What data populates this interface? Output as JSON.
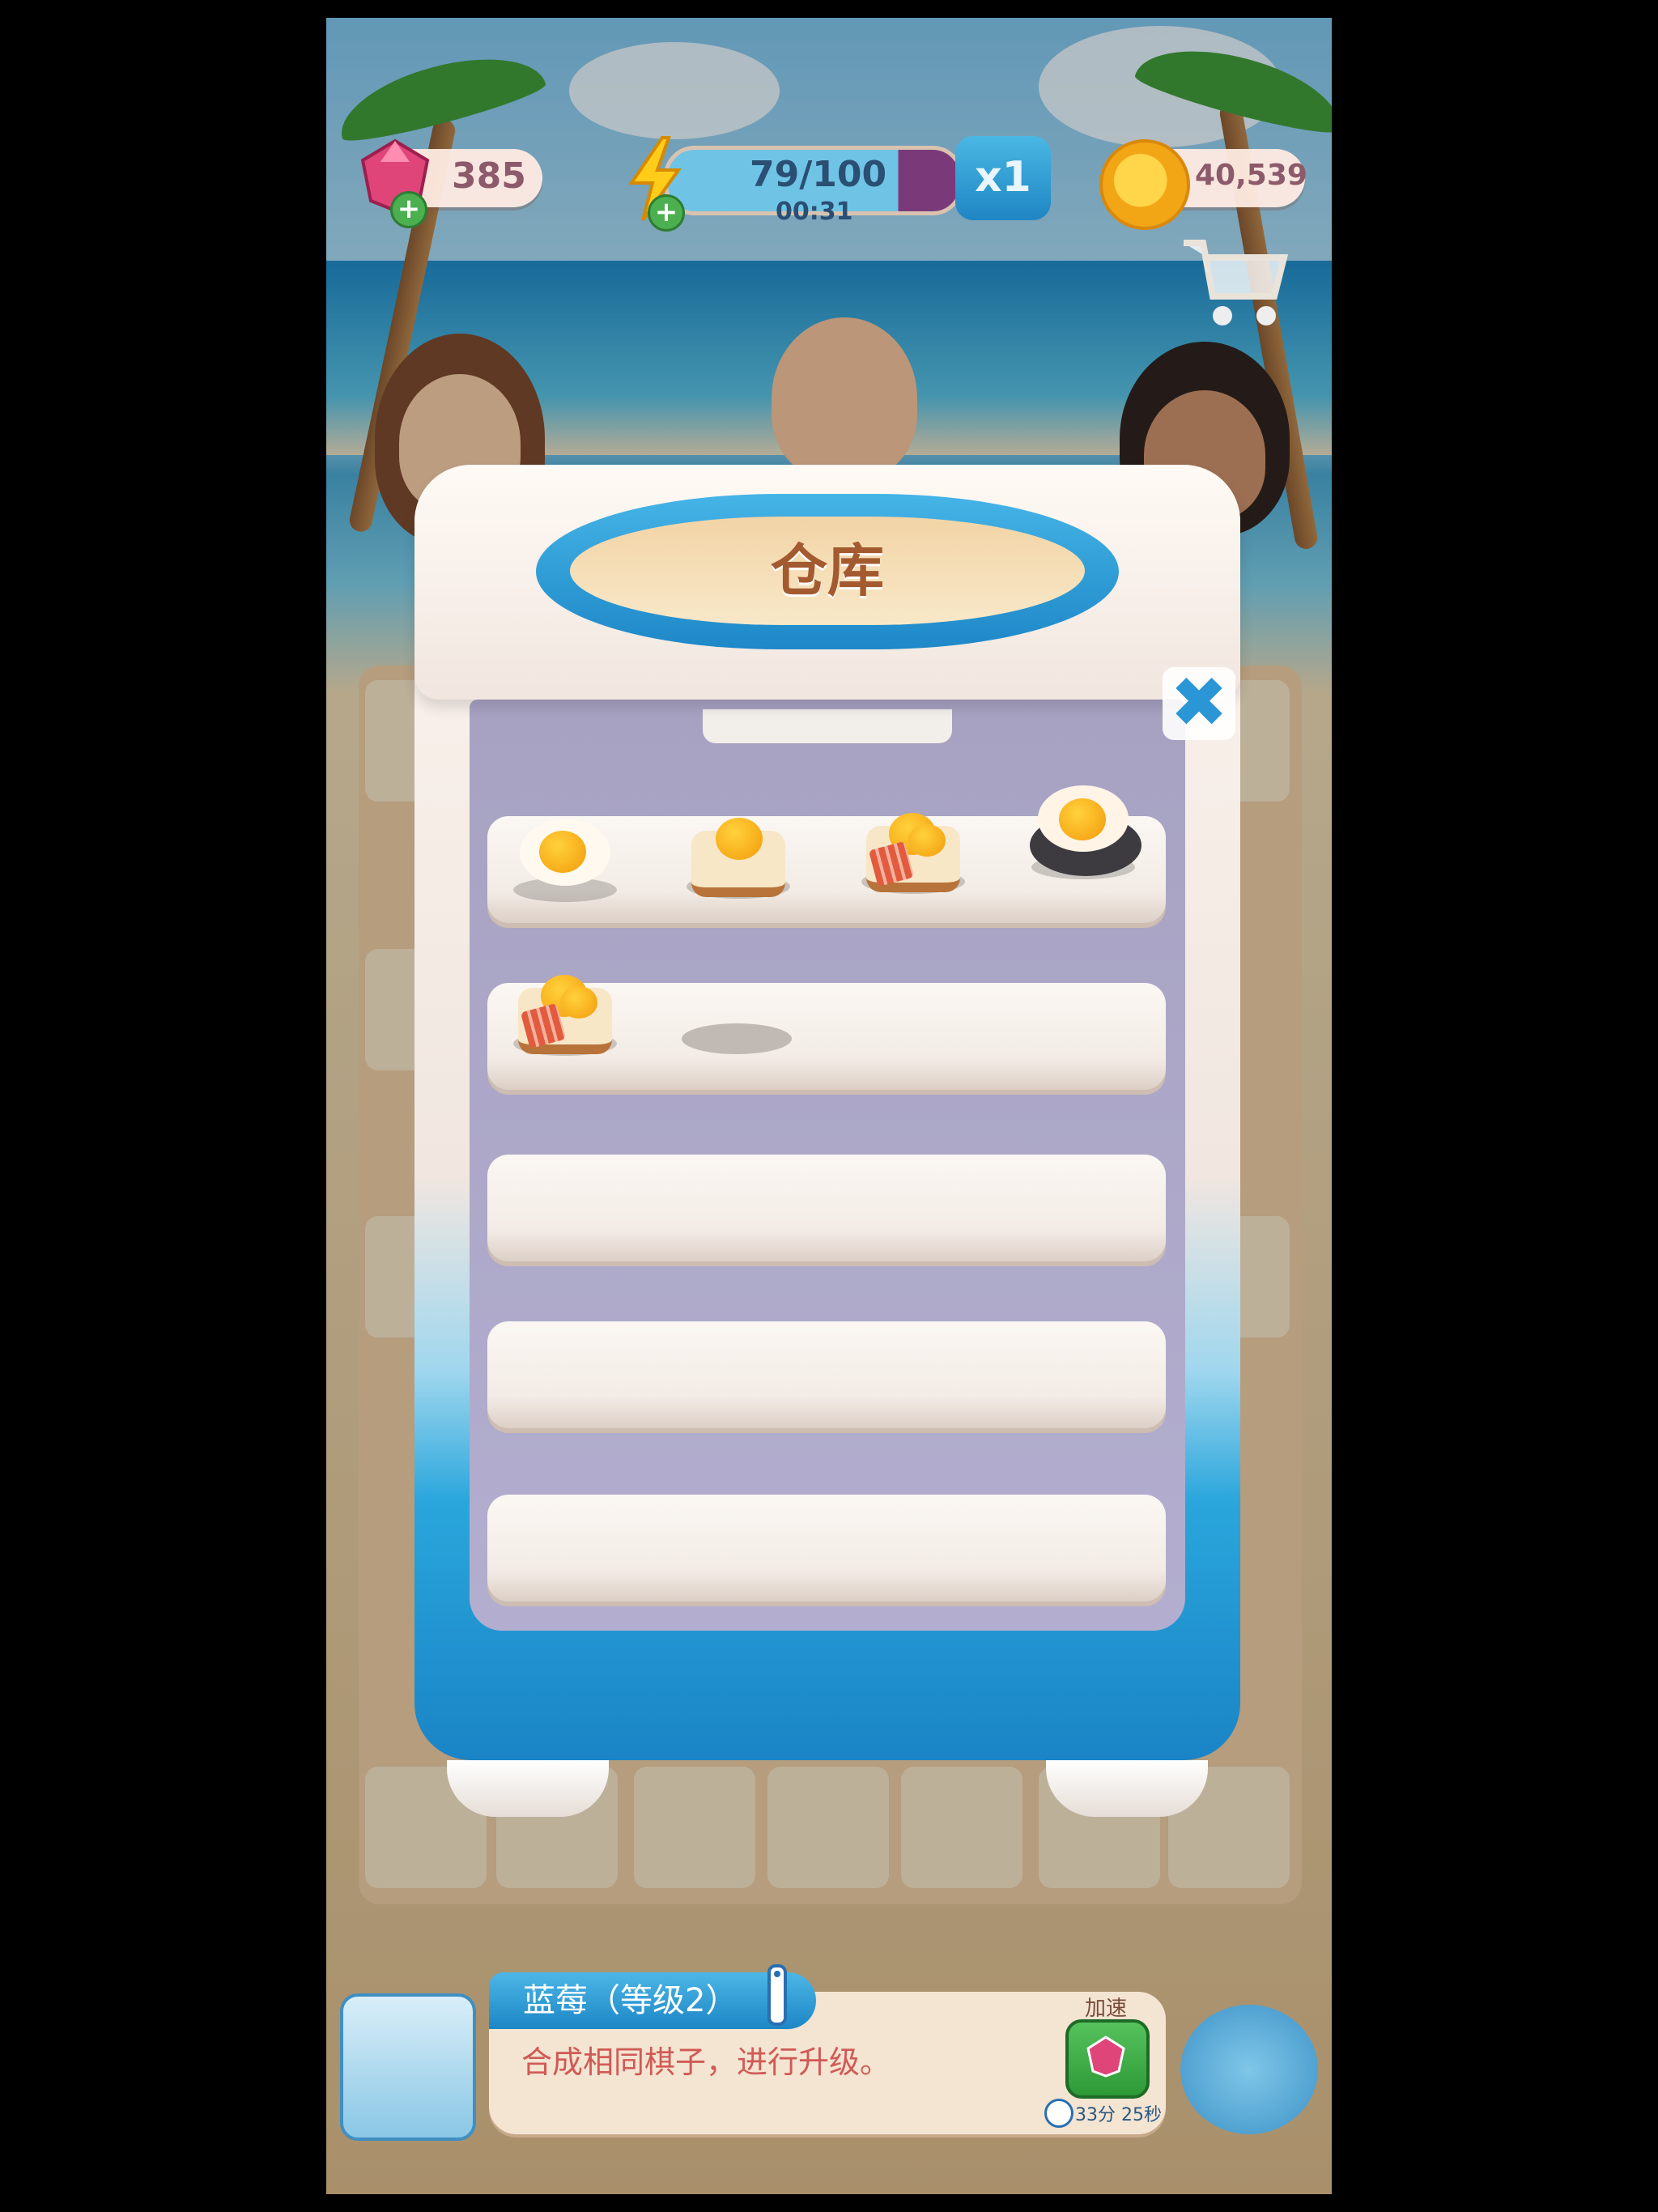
{
  "hud": {
    "gems": "385",
    "energy": "79/100",
    "energy_timer": "00:31",
    "multiplier": "x1",
    "coins": "40,539"
  },
  "modal": {
    "title": "仓库",
    "close_label": "✖"
  },
  "storage": {
    "shelf1": [
      "fried-egg",
      "egg-toast",
      "bacon-egg-toast",
      "steak-egg-skillet"
    ],
    "shelf2": [
      "bacon-egg-toast",
      "empty"
    ]
  },
  "info": {
    "item_title": "蓝莓（等级2）",
    "description": "合成相同棋子，进行升级。",
    "speed_label": "加速",
    "timer": "33分 25秒"
  },
  "colors": {
    "accent": "#1e88c8",
    "title_text": "#a45a2f",
    "desc_text": "#d05a55"
  }
}
